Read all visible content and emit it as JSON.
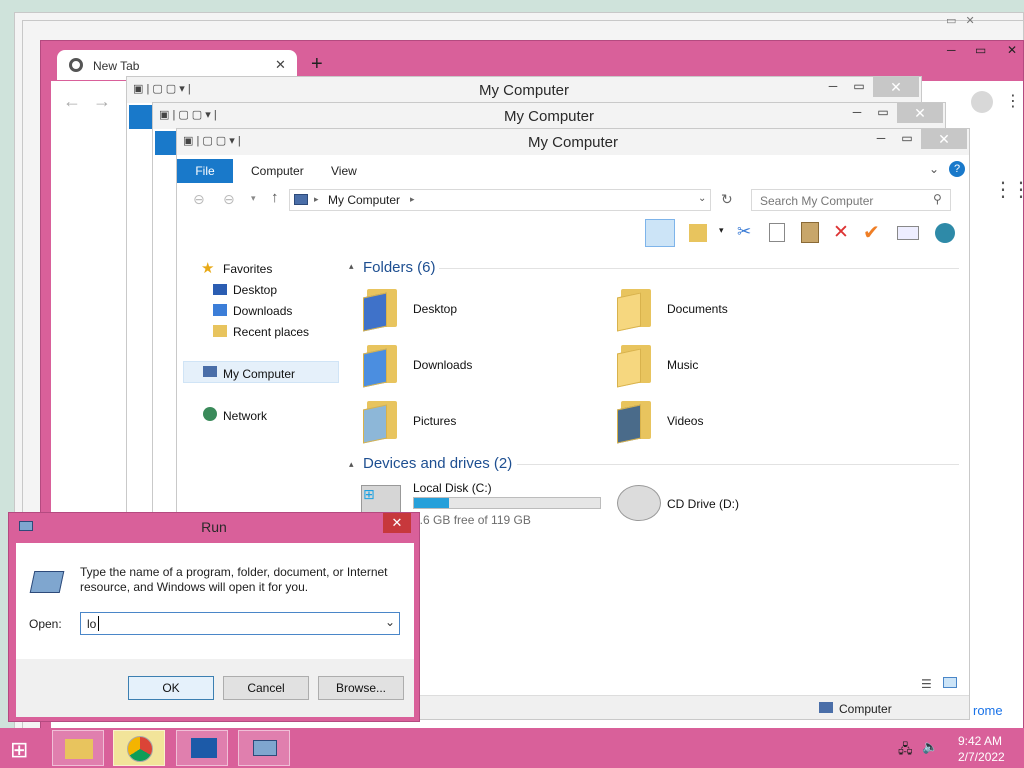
{
  "chrome": {
    "tab_title": "New Tab",
    "side_text": "rome"
  },
  "explorer_back1": {
    "title": "My Computer"
  },
  "explorer_back2": {
    "title": "My Computer"
  },
  "explorer": {
    "title": "My Computer",
    "tabs": {
      "file": "File",
      "computer": "Computer",
      "view": "View"
    },
    "address_path": "My Computer",
    "search_placeholder": "Search My Computer",
    "nav": {
      "favorites": "Favorites",
      "desktop": "Desktop",
      "downloads": "Downloads",
      "recent": "Recent places",
      "my_computer": "My Computer",
      "network": "Network"
    },
    "folders_header": "Folders (6)",
    "folders": [
      "Desktop",
      "Documents",
      "Downloads",
      "Music",
      "Pictures",
      "Videos"
    ],
    "devices_header": "Devices and drives (2)",
    "local_disk": {
      "name": "Local Disk (C:)",
      "free": "9.6 GB free of 119 GB",
      "used_fraction": 0.19
    },
    "cd_drive": "CD Drive (D:)",
    "status": "Computer"
  },
  "run": {
    "title": "Run",
    "description": "Type the name of a program, folder, document, or Internet resource, and Windows will open it for you.",
    "open_label": "Open:",
    "open_value": "lo",
    "ok": "OK",
    "cancel": "Cancel",
    "browse": "Browse..."
  },
  "taskbar": {
    "time": "9:42 AM",
    "date": "2/7/2022"
  },
  "colors": {
    "accent_pink": "#d9609a",
    "file_tab_blue": "#1979ca",
    "section_blue": "#1e4f91",
    "progress_blue": "#26a0da"
  }
}
